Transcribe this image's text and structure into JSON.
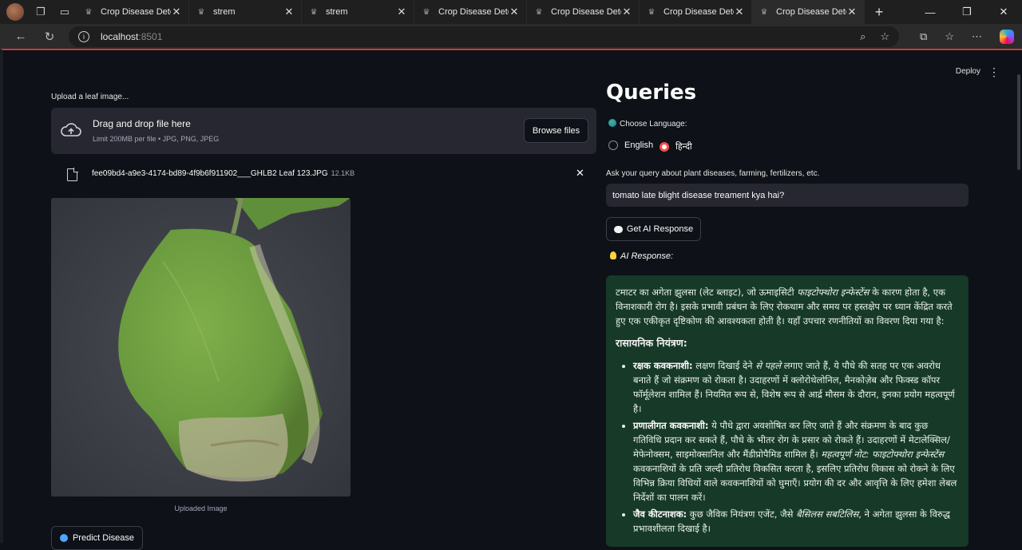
{
  "browser": {
    "tabs": [
      {
        "title": "Crop Disease Detecti",
        "active": false
      },
      {
        "title": "strem",
        "active": false
      },
      {
        "title": "strem",
        "active": false
      },
      {
        "title": "Crop Disease Detecti",
        "active": false
      },
      {
        "title": "Crop Disease Detecti",
        "active": false
      },
      {
        "title": "Crop Disease Detecti",
        "active": false
      },
      {
        "title": "Crop Disease Detecti",
        "active": true
      }
    ],
    "url_host": "localhost",
    "url_port": ":8501"
  },
  "app": {
    "deploy_label": "Deploy",
    "upload": {
      "label": "Upload a leaf image...",
      "drag_text": "Drag and drop file here",
      "limit_text": "Limit 200MB per file • JPG, PNG, JPEG",
      "browse_label": "Browse files",
      "file_name": "fee09bd4-a9e3-4174-bd89-4f9b6f911902___GHLB2 Leaf 123.JPG",
      "file_size": "12.1KB"
    },
    "image_caption": "Uploaded Image",
    "predict_label": "Predict Disease",
    "queries": {
      "title": "Queries",
      "language_label": "Choose Language:",
      "options": [
        "English",
        "हिन्दी"
      ],
      "selected": "हिन्दी",
      "query_label": "Ask your query about plant diseases, farming, fertilizers, etc.",
      "query_value": "tomato late blight disease treament kya hai?",
      "get_response_label": "Get AI Response",
      "ai_response_label": "AI Response:"
    },
    "response": {
      "intro_a": "टमाटर का अगेता झुलसा (लेट ब्लाइट), जो ऊमाइसिटी ",
      "intro_italic": "फाइटोफ्थोरा इन्फेस्टेंस",
      "intro_b": " के कारण होता है, एक विनाशकारी रोग है। इसके प्रभावी प्रबंधन के लिए रोकथाम और समय पर हस्तक्षेप पर ध्यान केंद्रित करते हुए एक एकीकृत दृष्टिकोण की आवश्यकता होती है। यहाँ उपचार रणनीतियों का विवरण दिया गया है:",
      "section_heading": "रासायनिक नियंत्रण:",
      "item1_title": "रक्षक कवकनाशी:",
      "item1_a": " लक्षण दिखाई देने ",
      "item1_italic": "से पहले",
      "item1_b": " लगाए जाते हैं, ये पौधे की सतह पर एक अवरोध बनाते हैं जो संक्रमण को रोकता है। उदाहरणों में क्लोरोथेलोनिल, मैनकोज़ेब और फिक्स्ड कॉपर फॉर्मूलेशन शामिल हैं। नियमित रूप से, विशेष रूप से आर्द्र मौसम के दौरान, इनका प्रयोग महत्वपूर्ण है।",
      "item2_title": "प्रणालीगत कवकनाशी:",
      "item2_a": " ये पौधे द्वारा अवशोषित कर लिए जाते हैं और संक्रमण के बाद कुछ गतिविधि प्रदान कर सकते हैं, पौधे के भीतर रोग के प्रसार को रोकते हैं। उदाहरणों में मेटालेक्सिल/मेफेनोक्सम, साइमोक्सानिल और मैंडीप्रोपैमिड शामिल हैं। ",
      "item2_italic": "महत्वपूर्ण नोट: फाइटोफ्थोरा इन्फेस्टेंस",
      "item2_b": " कवकनाशियों के प्रति जल्दी प्रतिरोध विकसित करता है, इसलिए प्रतिरोध विकास को रोकने के लिए विभिन्न क्रिया विधियों वाले कवकनाशियों को घुमाएँ। प्रयोग की दर और आवृत्ति के लिए हमेशा लेबल निर्देशों का पालन करें।",
      "item3_title": "जैव कीटनाशक:",
      "item3_a": " कुछ जैविक नियंत्रण एजेंट, जैसे ",
      "item3_italic": "बैसिलस सबटिलिस",
      "item3_b": ", ने अगेता झुलसा के विरुद्ध प्रभावशीलता दिखाई है।"
    }
  }
}
